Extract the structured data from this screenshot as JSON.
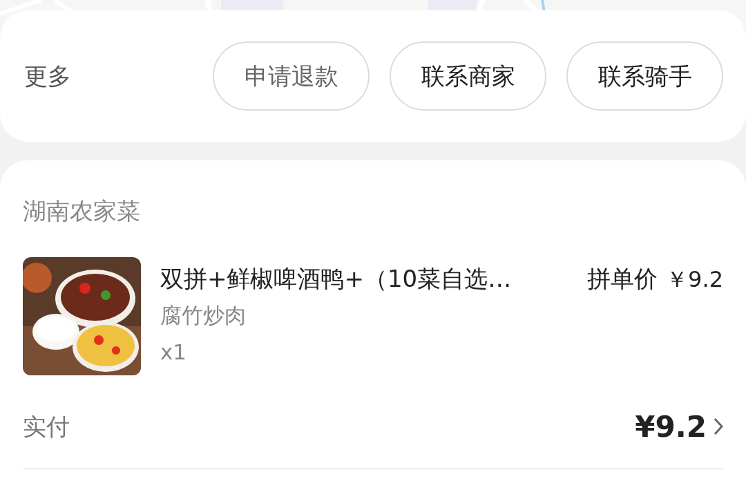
{
  "more": {
    "label": "更多",
    "buttons": [
      {
        "label": "申请退款",
        "disabled": true
      },
      {
        "label": "联系商家",
        "disabled": false
      },
      {
        "label": "联系骑手",
        "disabled": false
      }
    ]
  },
  "order": {
    "store": "湖南农家菜",
    "items": [
      {
        "kind": "picture",
        "title": "双拼+鲜椒啤酒鸭+（10菜自选…",
        "unit_price_label": "拼单价",
        "unit_price": "￥9.2",
        "option": "腐竹炒肉",
        "quantity": "x1"
      }
    ],
    "paid_label": "实付",
    "paid_amount": "¥9.2"
  }
}
